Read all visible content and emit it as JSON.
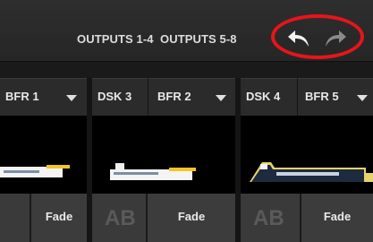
{
  "toolbar": {
    "tabs": [
      {
        "label": "OUTPUTS 1-4"
      },
      {
        "label": "OUTPUTS 5-8"
      }
    ],
    "undo_icon": "undo-arrow-icon",
    "redo_icon": "redo-arrow-icon",
    "highlight_color": "#e8141b"
  },
  "columns": [
    {
      "dsk": "",
      "bfr": "BFR 1",
      "fade": "Fade"
    },
    {
      "dsk": "DSK 3",
      "bfr": "BFR 2",
      "fade": "Fade"
    },
    {
      "dsk": "DSK 4",
      "bfr": "BFR 5",
      "fade": "Fade"
    }
  ],
  "ab_glyph": "AB",
  "colors": {
    "background": "#1c1c1c",
    "panel": "#2b2b2b",
    "button": "#3c3c3c"
  }
}
